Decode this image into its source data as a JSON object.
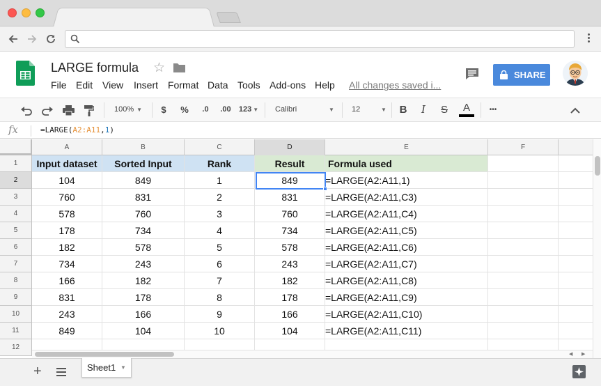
{
  "browser": {
    "back_icon": "arrow-left-icon",
    "forward_icon": "arrow-right-icon",
    "reload_icon": "reload-icon",
    "address": ""
  },
  "doc": {
    "title": "LARGE formula",
    "save_status": "All changes saved i...",
    "share_label": "SHARE",
    "menu": [
      "File",
      "Edit",
      "View",
      "Insert",
      "Format",
      "Data",
      "Tools",
      "Add-ons",
      "Help"
    ]
  },
  "toolbar": {
    "zoom": "100%",
    "currency": "$",
    "percent": "%",
    "decrease_decimals": ".0",
    "increase_decimals": ".00",
    "more_formats": "123",
    "font": "Calibri",
    "font_size": "12",
    "bold": "B",
    "italic": "I",
    "strikethrough": "S",
    "text_color": "A",
    "more": "•••"
  },
  "formula_bar": {
    "fx": "fx",
    "prefix": "=LARGE(",
    "range": "A2:A11",
    "comma": ",",
    "k": "1",
    "suffix": ")"
  },
  "grid": {
    "columns": [
      "A",
      "B",
      "C",
      "D",
      "E",
      "F",
      ""
    ],
    "rows": [
      "1",
      "2",
      "3",
      "4",
      "5",
      "6",
      "7",
      "8",
      "9",
      "10",
      "11",
      "12"
    ],
    "headers": [
      "Input dataset",
      "Sorted Input",
      "Rank",
      "Result",
      "Formula used"
    ],
    "data": [
      [
        "104",
        "849",
        "1",
        "849",
        "=LARGE(A2:A11,1)"
      ],
      [
        "760",
        "831",
        "2",
        "831",
        "=LARGE(A2:A11,C3)"
      ],
      [
        "578",
        "760",
        "3",
        "760",
        "=LARGE(A2:A11,C4)"
      ],
      [
        "178",
        "734",
        "4",
        "734",
        "=LARGE(A2:A11,C5)"
      ],
      [
        "182",
        "578",
        "5",
        "578",
        "=LARGE(A2:A11,C6)"
      ],
      [
        "734",
        "243",
        "6",
        "243",
        "=LARGE(A2:A11,C7)"
      ],
      [
        "166",
        "182",
        "7",
        "182",
        "=LARGE(A2:A11,C8)"
      ],
      [
        "831",
        "178",
        "8",
        "178",
        "=LARGE(A2:A11,C9)"
      ],
      [
        "243",
        "166",
        "9",
        "166",
        "=LARGE(A2:A11,C10)"
      ],
      [
        "849",
        "104",
        "10",
        "104",
        "=LARGE(A2:A11,C11)"
      ]
    ],
    "header_colors": {
      "blue": "#cfe2f3",
      "green": "#d9ead3"
    },
    "selected_cell": "D2"
  },
  "sheets": {
    "tabs": [
      "Sheet1"
    ]
  },
  "colors": {
    "share_button": "#4a89dc",
    "selection": "#4285f4",
    "sheets_green": "#0f9d58"
  }
}
